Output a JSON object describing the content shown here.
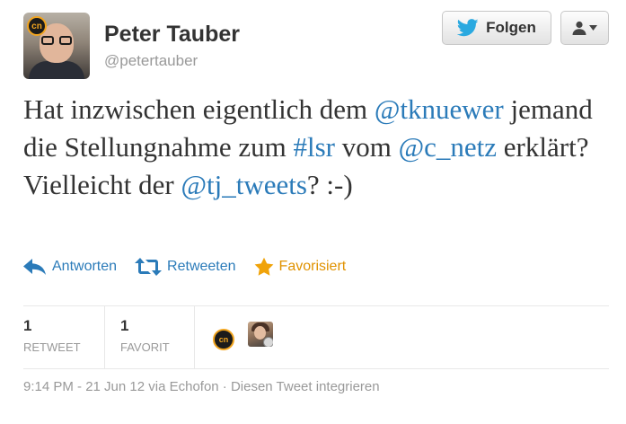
{
  "author": {
    "name": "Peter Tauber",
    "handle": "@petertauber",
    "avatar_badge": "cn"
  },
  "buttons": {
    "follow_label": "Folgen",
    "user_menu_icon": "user-dropdown-icon"
  },
  "tweet": {
    "segments": [
      {
        "text": "Hat inzwischen eigentlich dem ",
        "type": "text"
      },
      {
        "text": "@tknuewer",
        "type": "mention"
      },
      {
        "text": " jemand die Stellungnahme zum ",
        "type": "text"
      },
      {
        "text": "#lsr",
        "type": "hashtag"
      },
      {
        "text": " vom ",
        "type": "text"
      },
      {
        "text": "@c_netz",
        "type": "mention"
      },
      {
        "text": " erklärt? Vielleicht der ",
        "type": "text"
      },
      {
        "text": "@tj_tweets",
        "type": "mention"
      },
      {
        "text": "? :-)",
        "type": "text"
      }
    ]
  },
  "actions": {
    "reply": "Antworten",
    "retweet": "Retweeten",
    "favorite": "Favorisiert"
  },
  "stats": {
    "retweets_count": "1",
    "retweets_label": "RETWEET",
    "favorites_count": "1",
    "favorites_label": "FAVORIT"
  },
  "engagers": {
    "first_badge": "cn"
  },
  "footer": {
    "meta": "9:14 PM - 21 Jun 12 via Echofon · Diesen Tweet integrieren"
  },
  "colors": {
    "link": "#2b7bb9",
    "favorite": "#e09200",
    "twitter_bird": "#2aa9e0",
    "muted": "#999999"
  }
}
